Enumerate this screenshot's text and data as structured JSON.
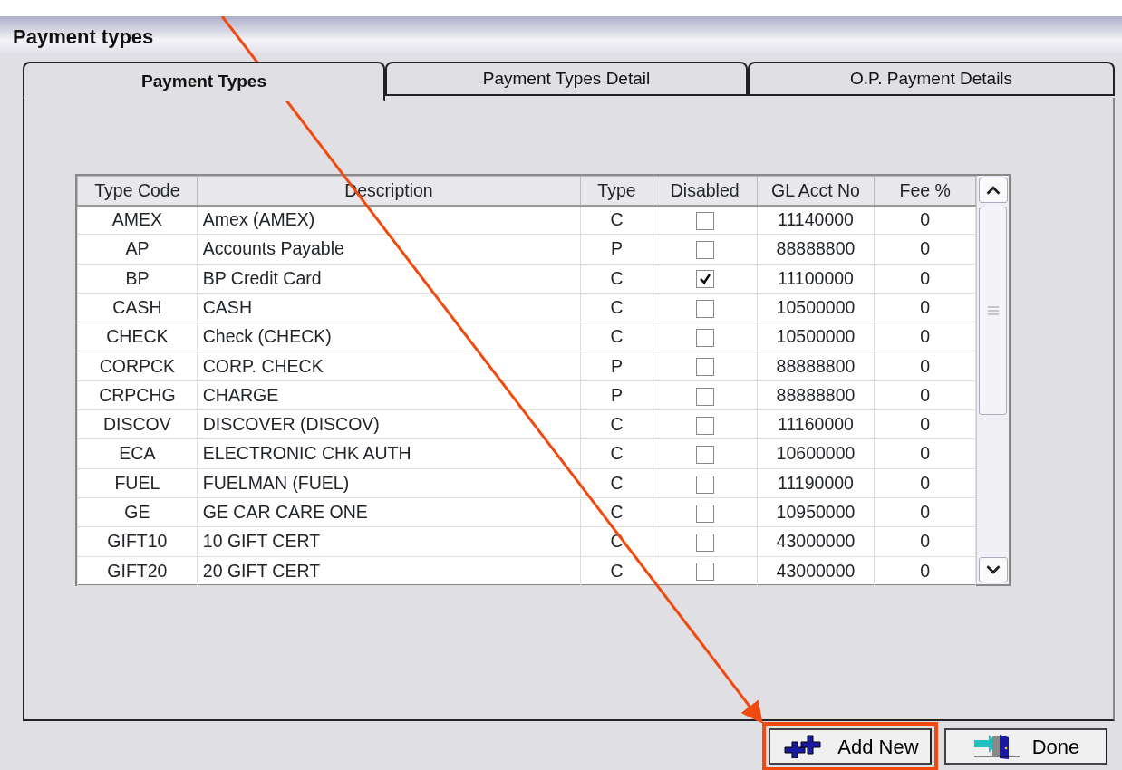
{
  "window": {
    "title": "Payment types"
  },
  "tabs": [
    {
      "label": "Payment Types",
      "selected": true
    },
    {
      "label": "Payment Types Detail",
      "selected": false
    },
    {
      "label": "O.P. Payment Details",
      "selected": false
    }
  ],
  "table": {
    "columns": [
      "Type Code",
      "Description",
      "Type",
      "Disabled",
      "GL Acct No",
      "Fee %"
    ],
    "rows": [
      {
        "code": "AMEX",
        "description": "Amex (AMEX)",
        "type": "C",
        "disabled": false,
        "gl": "11140000",
        "fee": "0"
      },
      {
        "code": "AP",
        "description": "Accounts Payable",
        "type": "P",
        "disabled": false,
        "gl": "88888800",
        "fee": "0"
      },
      {
        "code": "BP",
        "description": "BP Credit Card",
        "type": "C",
        "disabled": true,
        "gl": "11100000",
        "fee": "0"
      },
      {
        "code": "CASH",
        "description": "CASH",
        "type": "C",
        "disabled": false,
        "gl": "10500000",
        "fee": "0"
      },
      {
        "code": "CHECK",
        "description": "Check (CHECK)",
        "type": "C",
        "disabled": false,
        "gl": "10500000",
        "fee": "0"
      },
      {
        "code": "CORPCK",
        "description": "CORP. CHECK",
        "type": "P",
        "disabled": false,
        "gl": "88888800",
        "fee": "0"
      },
      {
        "code": "CRPCHG",
        "description": "CHARGE",
        "type": "P",
        "disabled": false,
        "gl": "88888800",
        "fee": "0"
      },
      {
        "code": "DISCOV",
        "description": "DISCOVER (DISCOV)",
        "type": "C",
        "disabled": false,
        "gl": "11160000",
        "fee": "0"
      },
      {
        "code": "ECA",
        "description": "ELECTRONIC CHK AUTH",
        "type": "C",
        "disabled": false,
        "gl": "10600000",
        "fee": "0"
      },
      {
        "code": "FUEL",
        "description": "FUELMAN (FUEL)",
        "type": "C",
        "disabled": false,
        "gl": "11190000",
        "fee": "0"
      },
      {
        "code": "GE",
        "description": "GE CAR CARE ONE",
        "type": "C",
        "disabled": false,
        "gl": "10950000",
        "fee": "0"
      },
      {
        "code": "GIFT10",
        "description": "10 GIFT CERT",
        "type": "C",
        "disabled": false,
        "gl": "43000000",
        "fee": "0"
      },
      {
        "code": "GIFT20",
        "description": "20 GIFT CERT",
        "type": "C",
        "disabled": false,
        "gl": "43000000",
        "fee": "0"
      }
    ]
  },
  "buttons": [
    {
      "label": "Add New",
      "kind": "add",
      "highlighted": true
    },
    {
      "label": "Done",
      "kind": "done",
      "highlighted": false
    }
  ]
}
